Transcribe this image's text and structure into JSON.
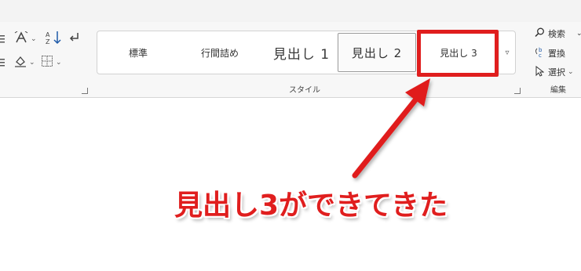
{
  "ribbon": {
    "font_tools": [
      {
        "name": "bullet-align-icon"
      },
      {
        "name": "character-spacing-icon"
      },
      {
        "name": "sort-icon"
      },
      {
        "name": "paragraph-mark-icon"
      },
      {
        "name": "shading-icon"
      },
      {
        "name": "borders-icon"
      }
    ],
    "styles": {
      "items": [
        "標準",
        "行間詰め",
        "見出し 1",
        "見出し 2",
        "見出し 3"
      ],
      "group_label": "スタイル"
    },
    "editing": {
      "find_label": "検索",
      "replace_label": "置換",
      "select_label": "選択",
      "group_label": "編集"
    }
  },
  "annotation": {
    "callout_text": "見出し3ができてきた",
    "highlight_color": "#e01e1e"
  }
}
